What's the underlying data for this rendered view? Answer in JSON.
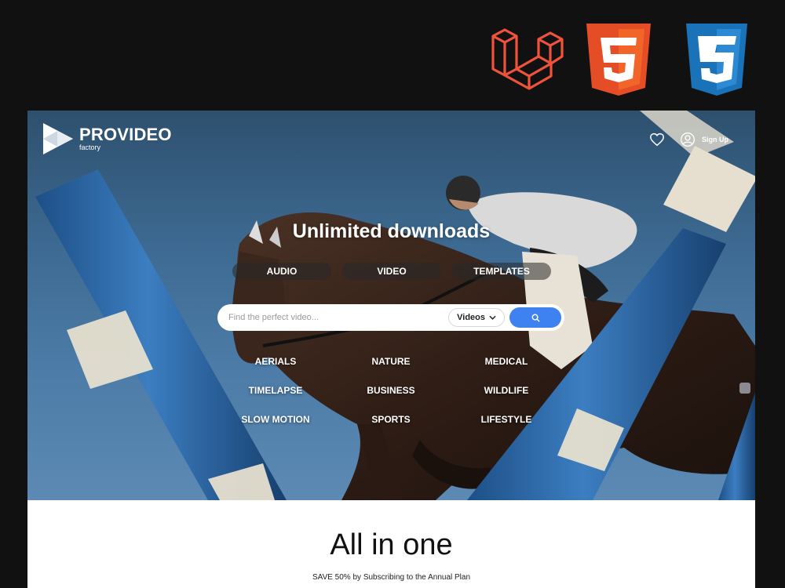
{
  "tech_logos": [
    {
      "name": "Laravel",
      "color": "#f0533b"
    },
    {
      "name": "HTML5",
      "color": "#e44d26",
      "symbol": "5"
    },
    {
      "name": "CSS3",
      "color": "#1a72b8",
      "symbol": "3"
    }
  ],
  "brand": {
    "name": "PROVIDEO",
    "sub": "factory"
  },
  "header": {
    "favorites_icon": "heart-icon",
    "account_icon": "user-circle-icon",
    "signup_label": "Sign Up"
  },
  "hero": {
    "headline": "Unlimited downloads",
    "tabs": [
      {
        "label": "AUDIO"
      },
      {
        "label": "VIDEO"
      },
      {
        "label": "TEMPLATES"
      }
    ],
    "search": {
      "placeholder": "Find the perfect video...",
      "scope": "Videos",
      "button_icon": "search-icon"
    },
    "categories": [
      {
        "label": "AERIALS"
      },
      {
        "label": "NATURE"
      },
      {
        "label": "MEDICAL"
      },
      {
        "label": "TIMELAPSE"
      },
      {
        "label": "BUSINESS"
      },
      {
        "label": "WILDLIFE"
      },
      {
        "label": "SLOW MOTION"
      },
      {
        "label": "SPORTS"
      },
      {
        "label": "LIFESTYLE"
      }
    ]
  },
  "plans": {
    "title": "All in one",
    "subtitle": "SAVE 50% by Subscribing to the Annual Plan"
  },
  "colors": {
    "page_bg": "#121112",
    "accent": "#3d82f0",
    "sky": "#3d6a92"
  }
}
